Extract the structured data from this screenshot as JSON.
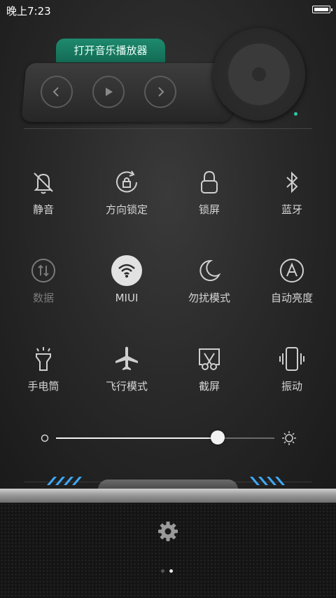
{
  "status_bar": {
    "time": "晚上7:23",
    "battery_level": 1.0
  },
  "music": {
    "open_player_label": "打开音乐播放器",
    "controls": [
      "previous-icon",
      "play-icon",
      "next-icon"
    ],
    "accent": "#1e8a6e"
  },
  "toggles": [
    {
      "label": "静音",
      "icon": "bell-off-icon",
      "state": "off"
    },
    {
      "label": "方向锁定",
      "icon": "rotation-lock-icon",
      "state": "off"
    },
    {
      "label": "锁屏",
      "icon": "lock-icon",
      "state": "off"
    },
    {
      "label": "蓝牙",
      "icon": "bluetooth-icon",
      "state": "off"
    },
    {
      "label": "数据",
      "icon": "mobile-data-icon",
      "state": "disabled"
    },
    {
      "label": "MIUI",
      "icon": "wifi-icon",
      "state": "on"
    },
    {
      "label": "勿扰模式",
      "icon": "moon-icon",
      "state": "off"
    },
    {
      "label": "自动亮度",
      "icon": "auto-brightness-icon",
      "state": "off"
    },
    {
      "label": "手电筒",
      "icon": "flashlight-icon",
      "state": "off"
    },
    {
      "label": "飞行模式",
      "icon": "airplane-icon",
      "state": "off"
    },
    {
      "label": "截屏",
      "icon": "screenshot-icon",
      "state": "off"
    },
    {
      "label": "振动",
      "icon": "vibrate-icon",
      "state": "off"
    }
  ],
  "brightness": {
    "level": 0.74
  },
  "pager": {
    "pages": 2,
    "current": 2
  },
  "colors": {
    "handle_stripes": "#3fa9f5",
    "active_toggle_bg": "#e2e2e2"
  }
}
